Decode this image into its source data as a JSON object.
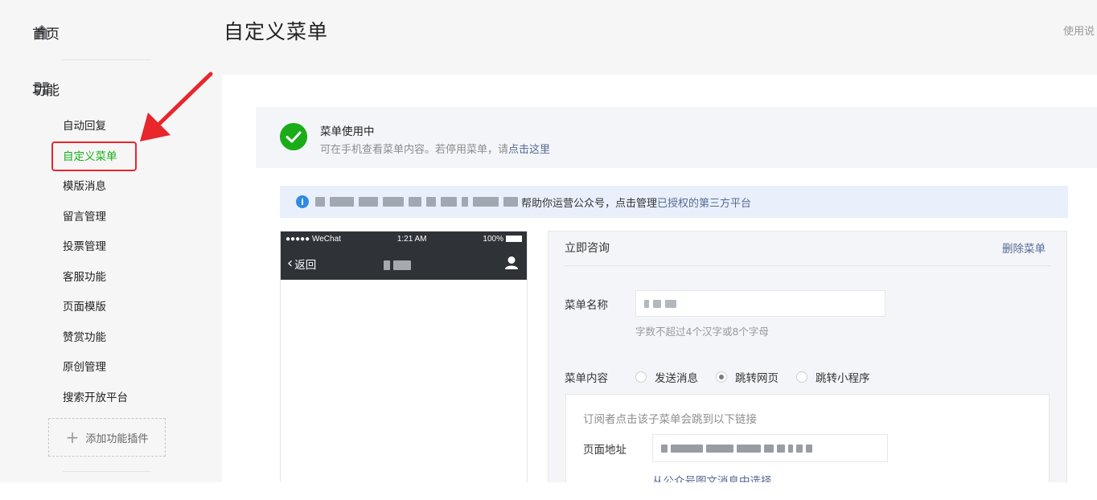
{
  "sidebar": {
    "home_label": "首页",
    "function_label": "功能",
    "items": [
      {
        "label": "自动回复",
        "active": false
      },
      {
        "label": "自定义菜单",
        "active": true
      },
      {
        "label": "模版消息",
        "active": false
      },
      {
        "label": "留言管理",
        "active": false
      },
      {
        "label": "投票管理",
        "active": false
      },
      {
        "label": "客服功能",
        "active": false
      },
      {
        "label": "页面模版",
        "active": false
      },
      {
        "label": "赞赏功能",
        "active": false
      },
      {
        "label": "原创管理",
        "active": false
      },
      {
        "label": "搜索开放平台",
        "active": false
      }
    ],
    "add_plugin_label": "添加功能插件"
  },
  "header": {
    "title": "自定义菜单",
    "help_label": "使用说"
  },
  "status": {
    "title": "菜单使用中",
    "subtitle": "可在手机查看菜单内容。若停用菜单，请",
    "subtitle_link": "点击这里"
  },
  "info_bar": {
    "icon": "info-icon",
    "text": "帮助你运营公众号，点击管理",
    "link": "已授权的第三方平台"
  },
  "phone": {
    "carrier": "●●●●● WeChat",
    "time": "1:21 AM",
    "battery": "100%",
    "back_label": "返回"
  },
  "editor": {
    "menu_title": "立即咨询",
    "delete_label": "删除菜单",
    "name_label": "菜单名称",
    "name_hint": "字数不超过4个汉字或8个字母",
    "content_label": "菜单内容",
    "options": [
      {
        "label": "发送消息",
        "checked": false
      },
      {
        "label": "跳转网页",
        "checked": true
      },
      {
        "label": "跳转小程序",
        "checked": false
      }
    ],
    "link_desc": "订阅者点击该子菜单会跳到以下链接",
    "url_label": "页面地址",
    "from_article_link": "从公众号图文消息中选择"
  },
  "colors": {
    "accent_green": "#1aad19",
    "link_blue": "#576b95",
    "highlight_red": "#e8262c"
  }
}
